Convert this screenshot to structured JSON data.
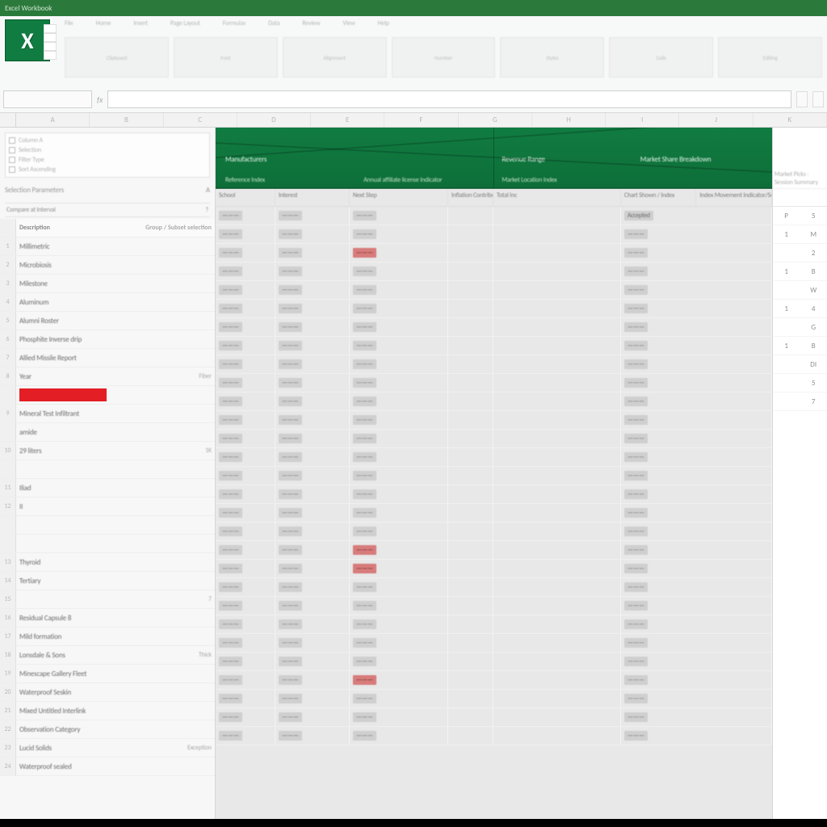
{
  "title_bar": "Excel Workbook",
  "ribbon": {
    "tabs": [
      "File",
      "Home",
      "Insert",
      "Page Layout",
      "Formulas",
      "Data",
      "Review",
      "View",
      "Help"
    ],
    "groups": [
      "Clipboard",
      "Font",
      "Alignment",
      "Number",
      "Styles",
      "Cells",
      "Editing"
    ]
  },
  "namebox": "",
  "fx_label": "fx",
  "mini_chips": [
    "",
    ""
  ],
  "column_letters": [
    "A",
    "B",
    "C",
    "D",
    "E",
    "F",
    "G",
    "H",
    "I",
    "J",
    "K"
  ],
  "left": {
    "filter_lines": [
      "Column A",
      "Selection",
      "Filter Type",
      "Sort Ascending"
    ],
    "sub1_left": "Selection Parameters",
    "sub1_right": "A",
    "sub2_left": "Compare at Interval",
    "sub2_right": "?",
    "header": {
      "primary": "Description",
      "aux": "Group / Subset selection"
    },
    "rows": [
      {
        "rh": "1",
        "primary": "Millimetric",
        "aux": ""
      },
      {
        "rh": "2",
        "primary": "Microbiosis",
        "aux": ""
      },
      {
        "rh": "3",
        "primary": "Milestone",
        "aux": ""
      },
      {
        "rh": "4",
        "primary": "Aluminum",
        "aux": ""
      },
      {
        "rh": "5",
        "primary": "Alumni Roster",
        "aux": ""
      },
      {
        "rh": "6",
        "primary": "Phosphite Inverse drip",
        "aux": ""
      },
      {
        "rh": "7",
        "primary": "Allied Missile Report",
        "aux": ""
      },
      {
        "rh": "8",
        "primary": "Year",
        "aux": "Fiber"
      },
      {
        "rh": "",
        "primary": "RED",
        "aux": "",
        "red": true
      },
      {
        "rh": "9",
        "primary": "Mineral Test Infiltrant",
        "aux": ""
      },
      {
        "rh": "",
        "primary": "amide",
        "aux": ""
      },
      {
        "rh": "10",
        "primary": "29 liters",
        "aux": "1K"
      },
      {
        "rh": "",
        "primary": "",
        "aux": ""
      },
      {
        "rh": "11",
        "primary": "Iliad",
        "aux": ""
      },
      {
        "rh": "12",
        "primary": "II",
        "aux": ""
      },
      {
        "rh": "",
        "primary": "",
        "aux": ""
      },
      {
        "rh": "",
        "primary": "",
        "aux": ""
      },
      {
        "rh": "13",
        "primary": "Thyroid",
        "aux": ""
      },
      {
        "rh": "14",
        "primary": "Tertiary",
        "aux": ""
      },
      {
        "rh": "15",
        "primary": "",
        "aux": "7"
      },
      {
        "rh": "16",
        "primary": "Residual Capsule 8",
        "aux": ""
      },
      {
        "rh": "17",
        "primary": "Mild formation",
        "aux": ""
      },
      {
        "rh": "18",
        "primary": "Lonsdale & Sons",
        "aux": "Thick"
      },
      {
        "rh": "19",
        "primary": "Minescape Gallery Fleet",
        "aux": ""
      },
      {
        "rh": "20",
        "primary": "Waterproof Seskin",
        "aux": ""
      },
      {
        "rh": "21",
        "primary": "Mixed Untitled Interlink",
        "aux": ""
      },
      {
        "rh": "22",
        "primary": "Observation Category",
        "aux": ""
      },
      {
        "rh": "23",
        "primary": "Lucid Solids",
        "aux": "Exception"
      },
      {
        "rh": "24",
        "primary": "Waterproof sealed",
        "aux": ""
      }
    ]
  },
  "main": {
    "green_top": [
      "Manufacturers",
      "",
      "Revenue Range",
      "Market Share Breakdown"
    ],
    "green_bot": [
      "Reference Index",
      "Annual affiliate license Indicator",
      "Market Location Index",
      ""
    ],
    "subheaders": [
      "School",
      "Interest",
      "Next Step",
      "Inflation Contribution",
      "Total Inc",
      "Chart Shown / Index",
      "Index Movement Indicator/Section"
    ],
    "rows": [
      {
        "a": "",
        "b": "",
        "c": "",
        "red": false,
        "f": "Accepted"
      },
      {
        "a": "",
        "b": "",
        "c": "",
        "red": false,
        "f": ""
      },
      {
        "a": "",
        "b": "",
        "c": "",
        "red": true,
        "f": ""
      },
      {
        "a": "",
        "b": "",
        "c": "",
        "red": false,
        "f": ""
      },
      {
        "a": "",
        "b": "",
        "c": "",
        "red": false,
        "f": ""
      },
      {
        "a": "",
        "b": "",
        "c": "",
        "red": false,
        "f": ""
      },
      {
        "a": "",
        "b": "",
        "c": "",
        "red": false,
        "f": ""
      },
      {
        "a": "",
        "b": "",
        "c": "",
        "red": false,
        "f": ""
      },
      {
        "a": "",
        "b": "",
        "c": "",
        "red": false,
        "f": ""
      },
      {
        "a": "",
        "b": "",
        "c": "",
        "red": false,
        "f": ""
      },
      {
        "a": "",
        "b": "",
        "c": "",
        "red": false,
        "f": ""
      },
      {
        "a": "",
        "b": "",
        "c": "",
        "red": false,
        "f": ""
      },
      {
        "a": "",
        "b": "",
        "c": "",
        "red": false,
        "f": ""
      },
      {
        "a": "",
        "b": "",
        "c": "",
        "red": false,
        "f": ""
      },
      {
        "a": "",
        "b": "",
        "c": "",
        "red": false,
        "f": ""
      },
      {
        "a": "",
        "b": "",
        "c": "",
        "red": false,
        "f": ""
      },
      {
        "a": "",
        "b": "",
        "c": "",
        "red": false,
        "f": ""
      },
      {
        "a": "",
        "b": "",
        "c": "",
        "red": false,
        "f": ""
      },
      {
        "a": "",
        "b": "",
        "c": "",
        "red": true,
        "f": ""
      },
      {
        "a": "",
        "b": "",
        "c": "",
        "red": true,
        "f": ""
      },
      {
        "a": "",
        "b": "",
        "c": "",
        "red": false,
        "f": ""
      },
      {
        "a": "",
        "b": "",
        "c": "",
        "red": false,
        "f": ""
      },
      {
        "a": "",
        "b": "",
        "c": "",
        "red": false,
        "f": ""
      },
      {
        "a": "",
        "b": "",
        "c": "",
        "red": false,
        "f": ""
      },
      {
        "a": "",
        "b": "",
        "c": "",
        "red": false,
        "f": ""
      },
      {
        "a": "",
        "b": "",
        "c": "",
        "red": true,
        "f": ""
      },
      {
        "a": "",
        "b": "",
        "c": "",
        "red": false,
        "f": ""
      },
      {
        "a": "",
        "b": "",
        "c": "",
        "red": false,
        "f": ""
      },
      {
        "a": "",
        "b": "",
        "c": "",
        "red": false,
        "f": ""
      }
    ]
  },
  "right": {
    "top_label": "Market Picks · Session Summary",
    "subhdr": [
      "",
      ""
    ],
    "rows": [
      [
        "P",
        "5"
      ],
      [
        "1",
        "M"
      ],
      [
        "",
        "2"
      ],
      [
        "1",
        "B"
      ],
      [
        "",
        "W"
      ],
      [
        "1",
        "4"
      ],
      [
        "",
        "G"
      ],
      [
        "1",
        "B"
      ],
      [
        "",
        "DI"
      ],
      [
        "",
        "5"
      ],
      [
        "",
        "7"
      ]
    ]
  }
}
